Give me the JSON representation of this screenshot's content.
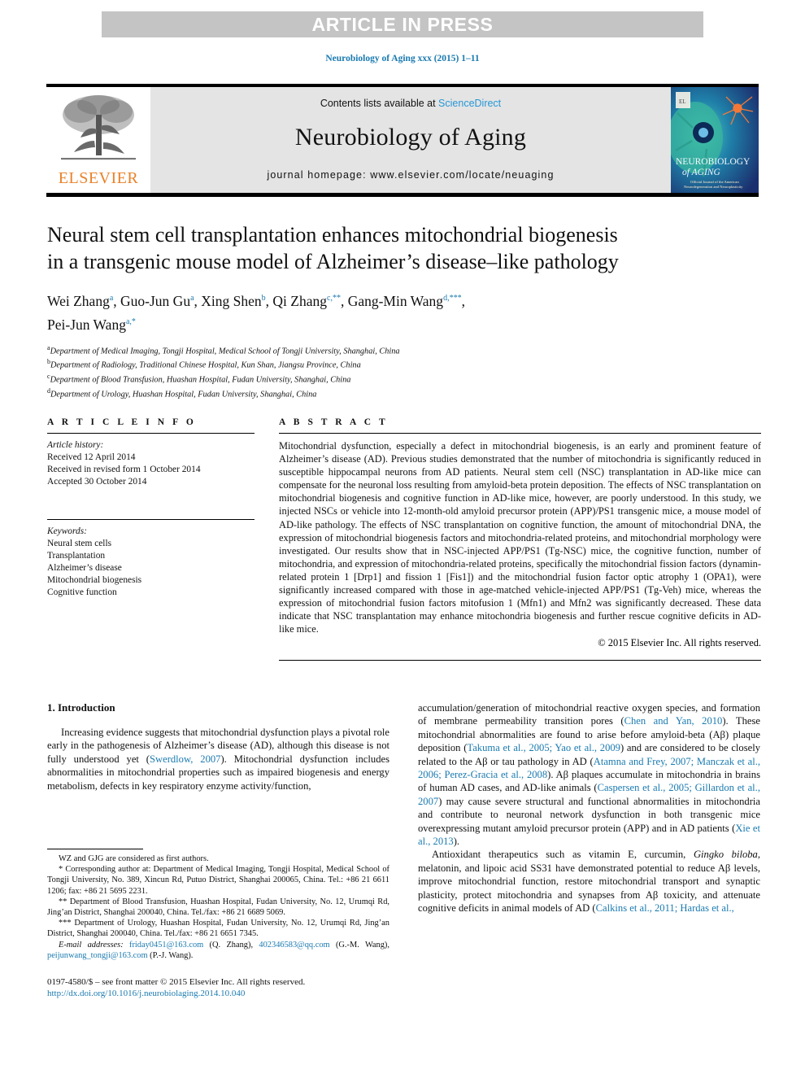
{
  "banner": {
    "label": "ARTICLE IN PRESS"
  },
  "running_head": {
    "text": "Neurobiology of Aging xxx (2015) 1–11",
    "color": "#1a7ab0"
  },
  "masthead": {
    "publisher_wordmark": "ELSEVIER",
    "publisher_color": "#e8822a",
    "contents_prefix": "Contents lists available at ",
    "contents_link": "ScienceDirect",
    "journal_title": "Neurobiology of Aging",
    "journal_homepage": "journal homepage: www.elsevier.com/locate/neuaging",
    "cover_title_line1": "NEUROBIOLOGY",
    "cover_title_line2": "of AGING",
    "cover_sub_line1": "Official Journal of the American",
    "cover_sub_line2": "Neurodegeneration and Neuroplasticity"
  },
  "article": {
    "title_line1": "Neural stem cell transplantation enhances mitochondrial biogenesis",
    "title_line2": "in a transgenic mouse model of Alzheimer’s disease–like pathology",
    "authors": [
      {
        "name": "Wei Zhang",
        "marks": "a"
      },
      {
        "name": "Guo-Jun Gu",
        "marks": "a"
      },
      {
        "name": "Xing Shen",
        "marks": "b"
      },
      {
        "name": "Qi Zhang",
        "marks": "c,**"
      },
      {
        "name": "Gang-Min Wang",
        "marks": "d,***"
      },
      {
        "name": "Pei-Jun Wang",
        "marks": "a,*"
      }
    ],
    "affiliations": [
      {
        "mark": "a",
        "text": "Department of Medical Imaging, Tongji Hospital, Medical School of Tongji University, Shanghai, China"
      },
      {
        "mark": "b",
        "text": "Department of Radiology, Traditional Chinese Hospital, Kun Shan, Jiangsu Province, China"
      },
      {
        "mark": "c",
        "text": "Department of Blood Transfusion, Huashan Hospital, Fudan University, Shanghai, China"
      },
      {
        "mark": "d",
        "text": "Department of Urology, Huashan Hospital, Fudan University, Shanghai, China"
      }
    ]
  },
  "article_info": {
    "heading": "A R T I C L E   I N F O",
    "history_label": "Article history:",
    "history": [
      "Received 12 April 2014",
      "Received in revised form 1 October 2014",
      "Accepted 30 October 2014"
    ],
    "keywords_label": "Keywords:",
    "keywords": [
      "Neural stem cells",
      "Transplantation",
      "Alzheimer’s disease",
      "Mitochondrial biogenesis",
      "Cognitive function"
    ]
  },
  "abstract": {
    "heading": "A B S T R A C T",
    "text": "Mitochondrial dysfunction, especially a defect in mitochondrial biogenesis, is an early and prominent feature of Alzheimer’s disease (AD). Previous studies demonstrated that the number of mitochondria is significantly reduced in susceptible hippocampal neurons from AD patients. Neural stem cell (NSC) transplantation in AD-like mice can compensate for the neuronal loss resulting from amyloid-beta protein deposition. The effects of NSC transplantation on mitochondrial biogenesis and cognitive function in AD-like mice, however, are poorly understood. In this study, we injected NSCs or vehicle into 12-month-old amyloid precursor protein (APP)/PS1 transgenic mice, a mouse model of AD-like pathology. The effects of NSC transplantation on cognitive function, the amount of mitochondrial DNA, the expression of mitochondrial biogenesis factors and mitochondria-related proteins, and mitochondrial morphology were investigated. Our results show that in NSC-injected APP/PS1 (Tg-NSC) mice, the cognitive function, number of mitochondria, and expression of mitochondria-related proteins, specifically the mitochondrial fission factors (dynamin-related protein 1 [Drp1] and fission 1 [Fis1]) and the mitochondrial fusion factor optic atrophy 1 (OPA1), were significantly increased compared with those in age-matched vehicle-injected APP/PS1 (Tg-Veh) mice, whereas the expression of mitochondrial fusion factors mitofusion 1 (Mfn1) and Mfn2 was significantly decreased. These data indicate that NSC transplantation may enhance mitochondria biogenesis and further rescue cognitive deficits in AD-like mice.",
    "copyright": "© 2015 Elsevier Inc. All rights reserved."
  },
  "body": {
    "section_heading": "1. Introduction",
    "left_paragraph_parts": [
      {
        "t": "Increasing evidence suggests that mitochondrial dysfunction plays a pivotal role early in the pathogenesis of Alzheimer’s disease (AD), although this disease is not fully understood yet (",
        "k": "plain"
      },
      {
        "t": "Swerdlow, 2007",
        "k": "cite"
      },
      {
        "t": "). Mitochondrial dysfunction includes abnormalities in mitochondrial properties such as impaired biogenesis and energy metabolism, defects in key respiratory enzyme activity/function,",
        "k": "plain"
      }
    ],
    "right_paragraph1_parts": [
      {
        "t": "accumulation/generation of mitochondrial reactive oxygen species, and formation of membrane permeability transition pores (",
        "k": "plain"
      },
      {
        "t": "Chen and Yan, 2010",
        "k": "cite"
      },
      {
        "t": "). These mitochondrial abnormalities are found to arise before amyloid-beta (Aβ) plaque deposition (",
        "k": "plain"
      },
      {
        "t": "Takuma et al., 2005; Yao et al., 2009",
        "k": "cite"
      },
      {
        "t": ") and are considered to be closely related to the Aβ or tau pathology in AD (",
        "k": "plain"
      },
      {
        "t": "Atamna and Frey, 2007; Manczak et al., 2006; Perez-Gracia et al., 2008",
        "k": "cite"
      },
      {
        "t": "). Aβ plaques accumulate in mitochondria in brains of human AD cases, and AD-like animals (",
        "k": "plain"
      },
      {
        "t": "Caspersen et al., 2005; Gillardon et al., 2007",
        "k": "cite"
      },
      {
        "t": ") may cause severe structural and functional abnormalities in mitochondria and contribute to neuronal network dysfunction in both transgenic mice overexpressing mutant amyloid precursor protein (APP) and in AD patients (",
        "k": "plain"
      },
      {
        "t": "Xie et al., 2013",
        "k": "cite"
      },
      {
        "t": ").",
        "k": "plain"
      }
    ],
    "right_paragraph2_parts": [
      {
        "t": "Antioxidant therapeutics such as vitamin E, curcumin, ",
        "k": "plain"
      },
      {
        "t": "Gingko biloba",
        "k": "ital"
      },
      {
        "t": ", melatonin, and lipoic acid SS31 have demonstrated potential to reduce Aβ levels, improve mitochondrial function, restore mitochondrial transport and synaptic plasticity, protect mitochondria and synapses from Aβ toxicity, and attenuate cognitive deficits in animal models of AD (",
        "k": "plain"
      },
      {
        "t": "Calkins et al., 2011; Hardas et al.,",
        "k": "cite"
      }
    ]
  },
  "footnotes": {
    "first_authors": "WZ and GJG are considered as first authors.",
    "corresponding": "* Corresponding author at: Department of Medical Imaging, Tongji Hospital, Medical School of Tongji University, No. 389, Xincun Rd, Putuo District, Shanghai 200065, China. Tel.: +86 21 6611 1206; fax: +86 21 5695 2231.",
    "corresponding2": "** Department of Blood Transfusion, Huashan Hospital, Fudan University, No. 12, Urumqi Rd, Jing’an District, Shanghai 200040, China. Tel./fax: +86 21 6689 5069.",
    "corresponding3": "*** Department of Urology, Huashan Hospital, Fudan University, No. 12, Urumqi Rd, Jing’an District, Shanghai 200040, China. Tel./fax: +86 21 6651 7345.",
    "email_label": "E-mail addresses:",
    "emails": [
      {
        "addr": "friday0451@163.com",
        "who": "(Q. Zhang)"
      },
      {
        "addr": "402346583@qq.com",
        "who": "(G.-M. Wang)"
      },
      {
        "addr": "peijunwang_tongji@163.com",
        "who": "(P.-J. Wang)"
      }
    ]
  },
  "colophon": {
    "issn_line": "0197-4580/$ – see front matter © 2015 Elsevier Inc. All rights reserved.",
    "doi": "http://dx.doi.org/10.1016/j.neurobiolaging.2014.10.040"
  }
}
